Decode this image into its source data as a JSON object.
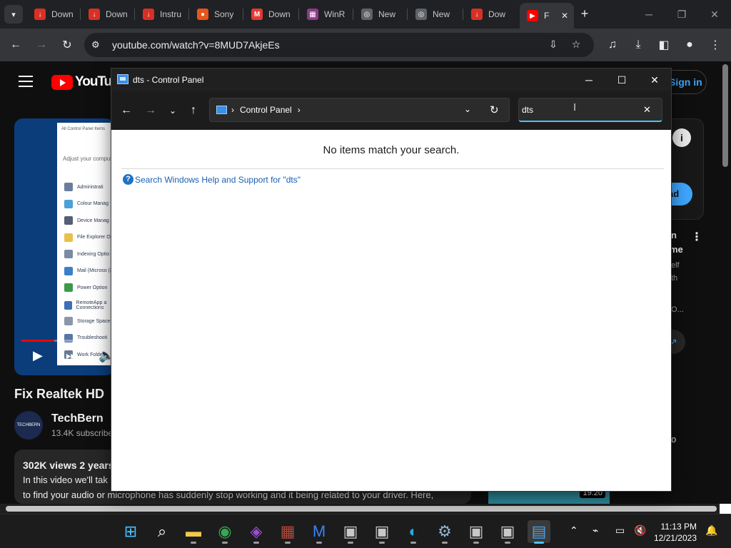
{
  "browser": {
    "tabs": [
      {
        "title": "Down",
        "fav_color": "#d93025",
        "fav_glyph": "↓"
      },
      {
        "title": "Down",
        "fav_color": "#d93025",
        "fav_glyph": "↓"
      },
      {
        "title": "Instru",
        "fav_color": "#d93025",
        "fav_glyph": "↓"
      },
      {
        "title": "Sony",
        "fav_color": "#e8541b",
        "fav_glyph": "●"
      },
      {
        "title": "Down",
        "fav_color": "#e53935",
        "fav_glyph": "M"
      },
      {
        "title": "WinR",
        "fav_color": "#8e3a8a",
        "fav_glyph": "▦"
      },
      {
        "title": "New",
        "fav_color": "#5f6368",
        "fav_glyph": "◎"
      },
      {
        "title": "New",
        "fav_color": "#5f6368",
        "fav_glyph": "◎"
      },
      {
        "title": "Dow",
        "fav_color": "#d93025",
        "fav_glyph": "↓"
      },
      {
        "title": "F",
        "fav_color": "#ff0000",
        "fav_glyph": "▶",
        "active": true
      }
    ],
    "url": "youtube.com/watch?v=8MUD7AkjeEs"
  },
  "youtube": {
    "logo_text": "YouTube",
    "signin_label": "Sign in",
    "video_title": "Fix Realtek HD",
    "channel_name": "TechBern",
    "channel_avatar_text": "TECHBERN",
    "subscribers": "13.4K subscribe",
    "views_line": "302K views  2 years",
    "desc_line1": "In this video we'll tak",
    "desc_line2": "to find your audio or microphone has suddenly stop working and it being related to your driver. Here,",
    "download_label": "ad",
    "side_text": [
      "n",
      "me",
      "elf",
      "th",
      "O..."
    ],
    "side_right_label": "o",
    "thumb_duration": "19:20",
    "progress_fraction": 0.35,
    "player_shot": {
      "title": "All Control Panel Items",
      "subtitle": "Adjust your compute",
      "items": [
        {
          "label": "Administrati",
          "color": "#6b7d9b"
        },
        {
          "label": "Colour Manag",
          "color": "#4aa0d8"
        },
        {
          "label": "Device Manag",
          "color": "#555f73"
        },
        {
          "label": "File Explorer O",
          "color": "#e8c14a"
        },
        {
          "label": "Indexing Optio",
          "color": "#7a8aa3"
        },
        {
          "label": "Mail (Microso (32-bit)",
          "color": "#3d7fc7"
        },
        {
          "label": "Power Option",
          "color": "#3d9a4c"
        },
        {
          "label": "RemoteApp a Connections",
          "color": "#3d6fb6"
        },
        {
          "label": "Storage Space",
          "color": "#8c96a8"
        },
        {
          "label": "Troubleshooti",
          "color": "#5a74a8"
        },
        {
          "label": "Work Folders",
          "color": "#6a7a92"
        }
      ]
    }
  },
  "control_panel": {
    "window_title": "dts - Control Panel",
    "breadcrumb": "Control Panel",
    "search_value": "dts",
    "no_match": "No items match your search.",
    "help_link": "Search Windows Help and Support for \"dts\""
  },
  "taskbar": {
    "apps": [
      {
        "name": "start-button",
        "glyph": "⊞",
        "color": "#4cc2ff"
      },
      {
        "name": "search",
        "glyph": "⌕",
        "color": "#ffffff"
      },
      {
        "name": "file-explorer",
        "glyph": "▬",
        "color": "#f5c84c"
      },
      {
        "name": "chrome",
        "glyph": "◉",
        "color": "#34a853"
      },
      {
        "name": "app-mask",
        "glyph": "◈",
        "color": "#9b4dd8"
      },
      {
        "name": "winrar",
        "glyph": "▦",
        "color": "#b5493d"
      },
      {
        "name": "app-m",
        "glyph": "M",
        "color": "#3b82f6"
      },
      {
        "name": "app-box-1",
        "glyph": "▣",
        "color": "#c8c8c8"
      },
      {
        "name": "app-box-2",
        "glyph": "▣",
        "color": "#c8c8c8"
      },
      {
        "name": "edge",
        "glyph": "◐",
        "color": "#1fb0e0"
      },
      {
        "name": "settings",
        "glyph": "⚙",
        "color": "#8fb4d8"
      },
      {
        "name": "app-box-3",
        "glyph": "▣",
        "color": "#c8c8c8"
      },
      {
        "name": "app-box-4",
        "glyph": "▣",
        "color": "#c8c8c8"
      },
      {
        "name": "control-panel",
        "glyph": "▤",
        "color": "#4ea3e8",
        "active": true
      }
    ],
    "time": "11:13 PM",
    "date": "12/21/2023"
  }
}
